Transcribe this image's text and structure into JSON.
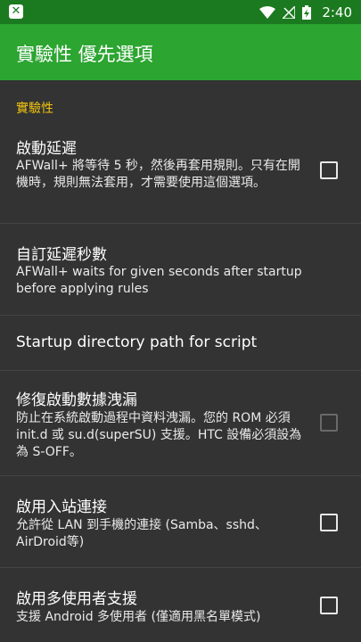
{
  "status_bar": {
    "time": "2:40",
    "icons": [
      "app-notification-icon",
      "wifi-icon",
      "no-signal-icon",
      "battery-charging-icon"
    ]
  },
  "toolbar": {
    "title": "實驗性 優先選項"
  },
  "category": {
    "label": "實驗性"
  },
  "preferences": [
    {
      "title": "啟動延遲",
      "summary": "AFWall+ 將等待 5 秒，然後再套用規則。只有在開機時，規則無法套用，才需要使用這個選項。",
      "checkbox": true,
      "checked": false,
      "enabled": true
    },
    {
      "title": "自訂延遲秒數",
      "summary": "AFWall+ waits for given seconds after startup before applying rules",
      "checkbox": false
    },
    {
      "title": "Startup directory path for script",
      "summary": "",
      "checkbox": false
    },
    {
      "title": "修復啟動數據洩漏",
      "summary": "防止在系統啟動過程中資料洩漏。您的 ROM 必須 init.d 或 su.d(superSU) 支援。HTC 設備必須設為為 S-OFF。",
      "checkbox": true,
      "checked": false,
      "enabled": false
    },
    {
      "title": "啟用入站連接",
      "summary": "允許從 LAN 到手機的連接 (Samba、sshd、AirDroid等)",
      "checkbox": true,
      "checked": false,
      "enabled": true
    },
    {
      "title": "啟用多使用者支援",
      "summary": "支援 Android 多使用者 (僅適用黑名單模式)",
      "checkbox": true,
      "checked": false,
      "enabled": true
    }
  ],
  "colors": {
    "status_bar": "#1b7a1f",
    "app_bar": "#2ca531",
    "background": "#333333",
    "category_accent": "#f1c40f"
  }
}
